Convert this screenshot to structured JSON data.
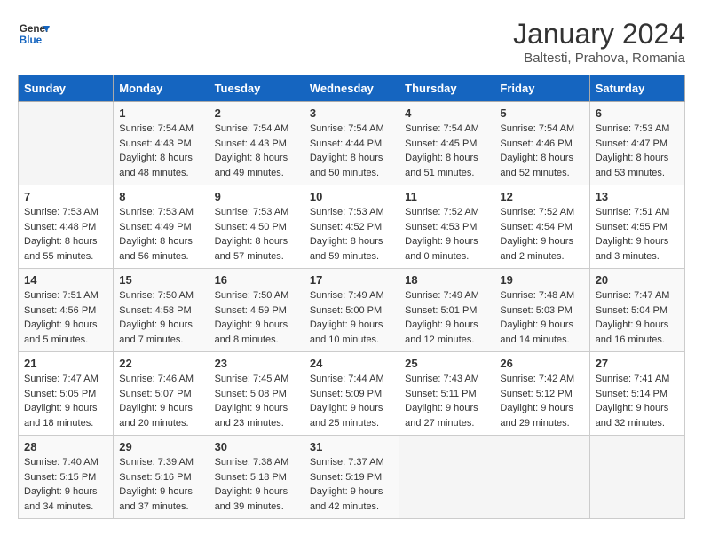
{
  "header": {
    "logo_general": "General",
    "logo_blue": "Blue",
    "month_title": "January 2024",
    "subtitle": "Baltesti, Prahova, Romania"
  },
  "days_of_week": [
    "Sunday",
    "Monday",
    "Tuesday",
    "Wednesday",
    "Thursday",
    "Friday",
    "Saturday"
  ],
  "weeks": [
    [
      {
        "day": "",
        "info": ""
      },
      {
        "day": "1",
        "info": "Sunrise: 7:54 AM\nSunset: 4:43 PM\nDaylight: 8 hours\nand 48 minutes."
      },
      {
        "day": "2",
        "info": "Sunrise: 7:54 AM\nSunset: 4:43 PM\nDaylight: 8 hours\nand 49 minutes."
      },
      {
        "day": "3",
        "info": "Sunrise: 7:54 AM\nSunset: 4:44 PM\nDaylight: 8 hours\nand 50 minutes."
      },
      {
        "day": "4",
        "info": "Sunrise: 7:54 AM\nSunset: 4:45 PM\nDaylight: 8 hours\nand 51 minutes."
      },
      {
        "day": "5",
        "info": "Sunrise: 7:54 AM\nSunset: 4:46 PM\nDaylight: 8 hours\nand 52 minutes."
      },
      {
        "day": "6",
        "info": "Sunrise: 7:53 AM\nSunset: 4:47 PM\nDaylight: 8 hours\nand 53 minutes."
      }
    ],
    [
      {
        "day": "7",
        "info": "Sunrise: 7:53 AM\nSunset: 4:48 PM\nDaylight: 8 hours\nand 55 minutes."
      },
      {
        "day": "8",
        "info": "Sunrise: 7:53 AM\nSunset: 4:49 PM\nDaylight: 8 hours\nand 56 minutes."
      },
      {
        "day": "9",
        "info": "Sunrise: 7:53 AM\nSunset: 4:50 PM\nDaylight: 8 hours\nand 57 minutes."
      },
      {
        "day": "10",
        "info": "Sunrise: 7:53 AM\nSunset: 4:52 PM\nDaylight: 8 hours\nand 59 minutes."
      },
      {
        "day": "11",
        "info": "Sunrise: 7:52 AM\nSunset: 4:53 PM\nDaylight: 9 hours\nand 0 minutes."
      },
      {
        "day": "12",
        "info": "Sunrise: 7:52 AM\nSunset: 4:54 PM\nDaylight: 9 hours\nand 2 minutes."
      },
      {
        "day": "13",
        "info": "Sunrise: 7:51 AM\nSunset: 4:55 PM\nDaylight: 9 hours\nand 3 minutes."
      }
    ],
    [
      {
        "day": "14",
        "info": "Sunrise: 7:51 AM\nSunset: 4:56 PM\nDaylight: 9 hours\nand 5 minutes."
      },
      {
        "day": "15",
        "info": "Sunrise: 7:50 AM\nSunset: 4:58 PM\nDaylight: 9 hours\nand 7 minutes."
      },
      {
        "day": "16",
        "info": "Sunrise: 7:50 AM\nSunset: 4:59 PM\nDaylight: 9 hours\nand 8 minutes."
      },
      {
        "day": "17",
        "info": "Sunrise: 7:49 AM\nSunset: 5:00 PM\nDaylight: 9 hours\nand 10 minutes."
      },
      {
        "day": "18",
        "info": "Sunrise: 7:49 AM\nSunset: 5:01 PM\nDaylight: 9 hours\nand 12 minutes."
      },
      {
        "day": "19",
        "info": "Sunrise: 7:48 AM\nSunset: 5:03 PM\nDaylight: 9 hours\nand 14 minutes."
      },
      {
        "day": "20",
        "info": "Sunrise: 7:47 AM\nSunset: 5:04 PM\nDaylight: 9 hours\nand 16 minutes."
      }
    ],
    [
      {
        "day": "21",
        "info": "Sunrise: 7:47 AM\nSunset: 5:05 PM\nDaylight: 9 hours\nand 18 minutes."
      },
      {
        "day": "22",
        "info": "Sunrise: 7:46 AM\nSunset: 5:07 PM\nDaylight: 9 hours\nand 20 minutes."
      },
      {
        "day": "23",
        "info": "Sunrise: 7:45 AM\nSunset: 5:08 PM\nDaylight: 9 hours\nand 23 minutes."
      },
      {
        "day": "24",
        "info": "Sunrise: 7:44 AM\nSunset: 5:09 PM\nDaylight: 9 hours\nand 25 minutes."
      },
      {
        "day": "25",
        "info": "Sunrise: 7:43 AM\nSunset: 5:11 PM\nDaylight: 9 hours\nand 27 minutes."
      },
      {
        "day": "26",
        "info": "Sunrise: 7:42 AM\nSunset: 5:12 PM\nDaylight: 9 hours\nand 29 minutes."
      },
      {
        "day": "27",
        "info": "Sunrise: 7:41 AM\nSunset: 5:14 PM\nDaylight: 9 hours\nand 32 minutes."
      }
    ],
    [
      {
        "day": "28",
        "info": "Sunrise: 7:40 AM\nSunset: 5:15 PM\nDaylight: 9 hours\nand 34 minutes."
      },
      {
        "day": "29",
        "info": "Sunrise: 7:39 AM\nSunset: 5:16 PM\nDaylight: 9 hours\nand 37 minutes."
      },
      {
        "day": "30",
        "info": "Sunrise: 7:38 AM\nSunset: 5:18 PM\nDaylight: 9 hours\nand 39 minutes."
      },
      {
        "day": "31",
        "info": "Sunrise: 7:37 AM\nSunset: 5:19 PM\nDaylight: 9 hours\nand 42 minutes."
      },
      {
        "day": "",
        "info": ""
      },
      {
        "day": "",
        "info": ""
      },
      {
        "day": "",
        "info": ""
      }
    ]
  ]
}
